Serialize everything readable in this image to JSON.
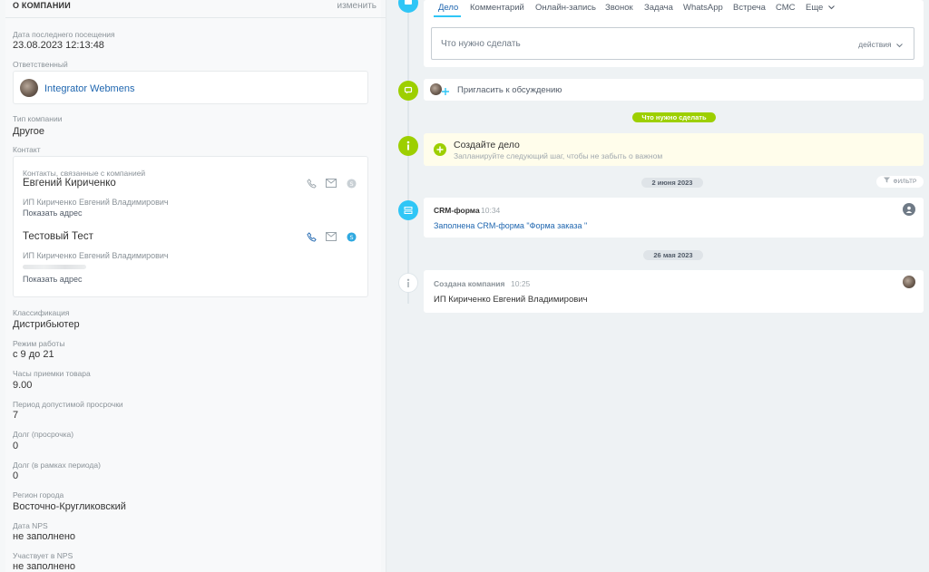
{
  "left": {
    "header": "О КОМПАНИИ",
    "edit": "изменить",
    "last_visit": {
      "label": "Дата последнего посещения",
      "value": "23.08.2023 12:13:48"
    },
    "responsible": {
      "label": "Ответственный",
      "name": "Integrator Webmens"
    },
    "company_type": {
      "label": "Тип компании",
      "value": "Другое"
    },
    "contact": {
      "label": "Контакт",
      "card_title": "Контакты, связанные с компанией",
      "items": [
        {
          "name": "Евгений Кириченко",
          "company": "ИП Кириченко Евгений Владимирович",
          "address": "Показать адрес"
        },
        {
          "name": "Тестовый Тест",
          "company": "ИП Кириченко Евгений Владимирович",
          "address": "Показать адрес"
        }
      ]
    },
    "fields": [
      {
        "label": "Классификация",
        "value": "Дистрибьютер"
      },
      {
        "label": "Режим работы",
        "value": "с 9 до 21"
      },
      {
        "label": "Часы приемки товара",
        "value": "9.00"
      },
      {
        "label": "Период допустимой просрочки",
        "value": "7"
      },
      {
        "label": "Долг (просрочка)",
        "value": "0"
      },
      {
        "label": "Долг (в рамках периода)",
        "value": "0"
      },
      {
        "label": "Регион города",
        "value": "Восточно-Кругликовский"
      },
      {
        "label": "Дата NPS",
        "value": "не заполнено"
      },
      {
        "label": "Участвует в NPS",
        "value": "не заполнено"
      }
    ]
  },
  "right": {
    "tabs": [
      "Дело",
      "Комментарий",
      "Онлайн-запись",
      "Звонок",
      "Задача",
      "WhatsApp",
      "Встреча",
      "СМС",
      "Еще"
    ],
    "todo_placeholder": "Что нужно сделать",
    "todo_actions": "действия",
    "invite": "Пригласить к обсуждению",
    "todo_pill": "Что нужно сделать",
    "create_task": {
      "title": "Создайте дело",
      "subtitle": "Запланируйте следующий шаг, чтобы не забыть о важном"
    },
    "date1": "2 июня 2023",
    "filter": "ФИЛЬТР",
    "crm_form": {
      "title": "CRM-форма",
      "time": "10:34",
      "text": "Заполнена CRM-форма \"Форма заказа \""
    },
    "date2": "26 мая 2023",
    "company_created": {
      "title": "Создана компания",
      "time": "10:25",
      "text": "ИП Кириченко Евгений Владимирович"
    }
  },
  "colors": {
    "accent": "#2fc6f6",
    "link": "#2067b0",
    "green": "#9dcf00",
    "highlight": "#fffdeb"
  }
}
